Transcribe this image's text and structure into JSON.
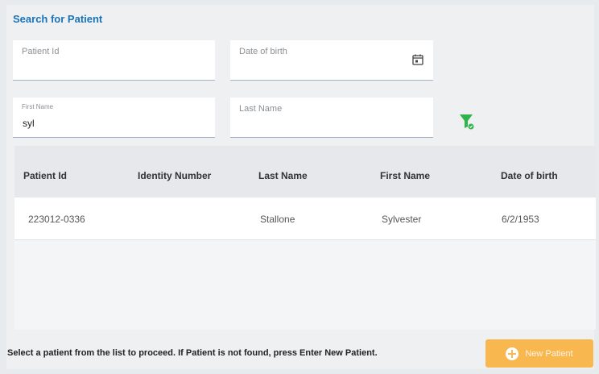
{
  "header": {
    "title": "Search for Patient"
  },
  "search": {
    "patient_id_label": "Patient Id",
    "patient_id_value": "",
    "dob_label": "Date of birth",
    "dob_value": "",
    "first_name_label": "First Name",
    "first_name_value": "syl",
    "last_name_label": "Last Name",
    "last_name_value": ""
  },
  "icons": {
    "calendar": "calendar-icon",
    "filter": "filter-icon",
    "add": "plus-circle-icon"
  },
  "colors": {
    "accent": "#1a73b8",
    "filter": "#2fb44a",
    "button": "#f8b74f"
  },
  "table": {
    "columns": [
      "Patient Id",
      "Identity Number",
      "Last Name",
      "First Name",
      "Date of birth"
    ],
    "rows": [
      {
        "patient_id": "223012-0336",
        "identity_number": "",
        "last_name": "Stallone",
        "first_name": "Sylvester",
        "dob": "6/2/1953"
      }
    ]
  },
  "footer": {
    "instruction": "Select a patient from the list to proceed. If Patient is not found, press Enter New Patient.",
    "new_patient_label": "New Patient"
  }
}
